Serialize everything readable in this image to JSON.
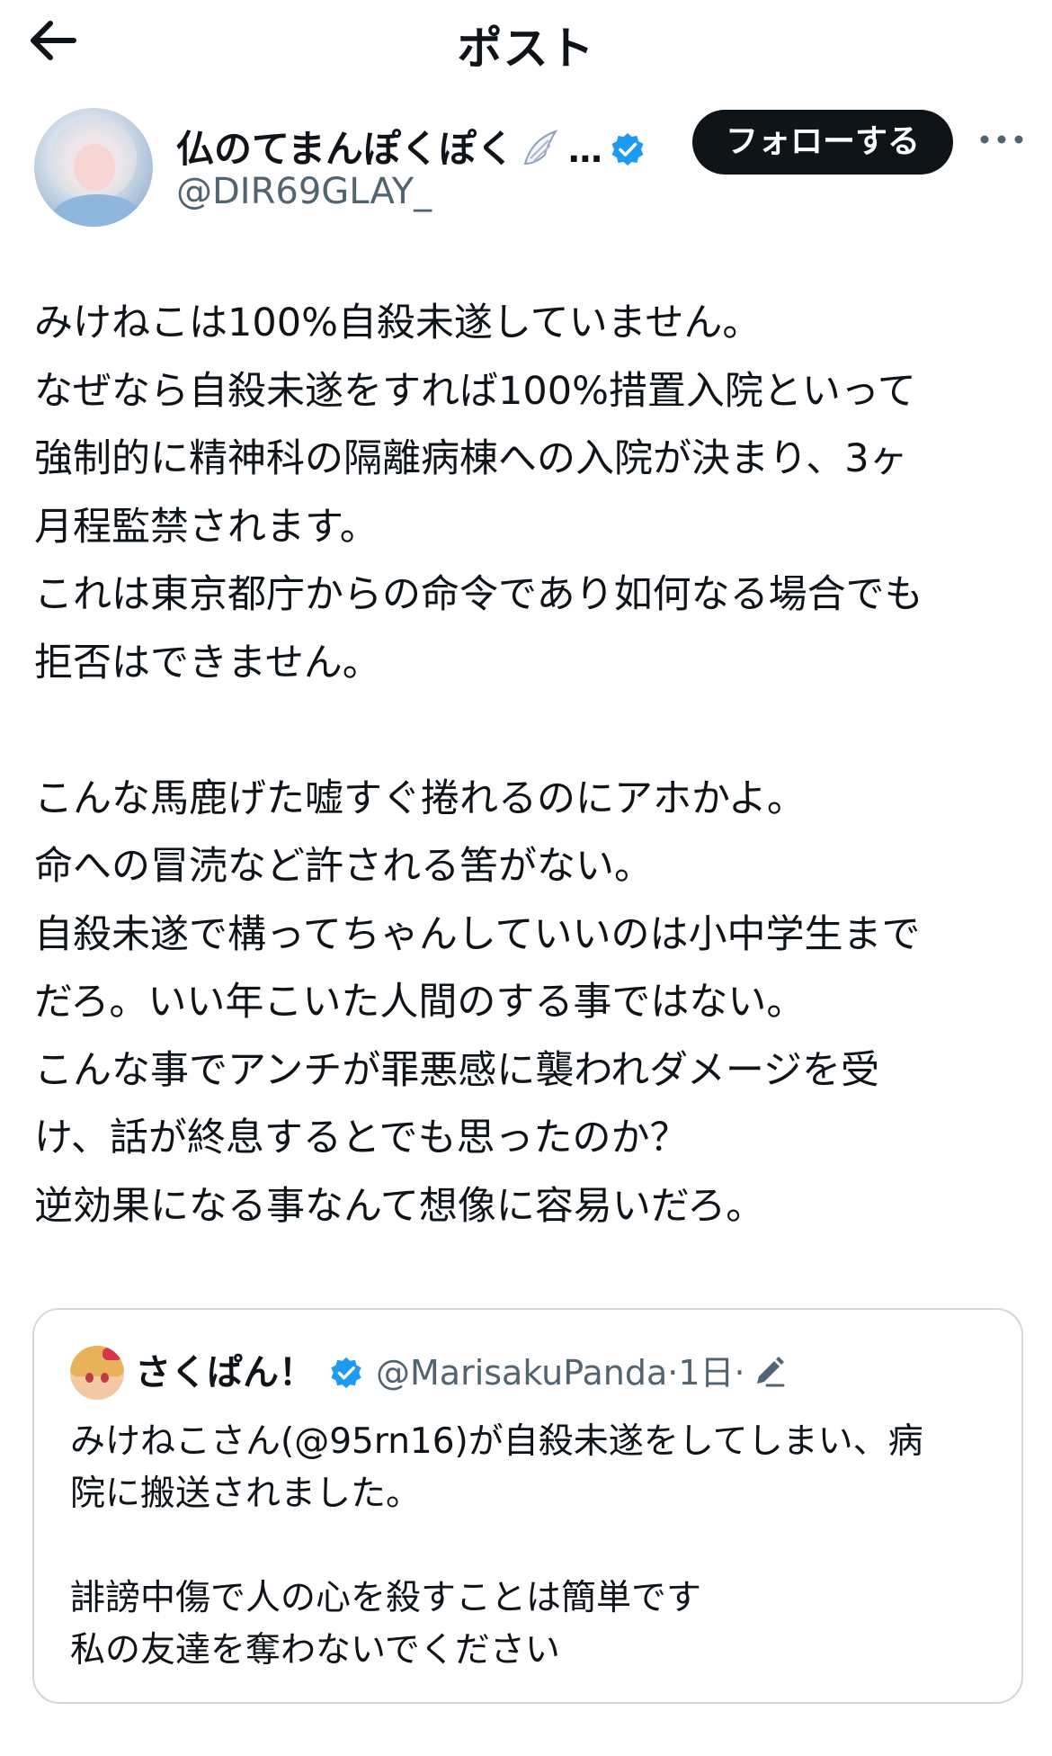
{
  "header": {
    "title": "ポスト"
  },
  "author": {
    "display_name": "仏のてまんぽくぽく",
    "name_ellipsis": "…",
    "handle": "@DIR69GLAY_",
    "follow_label": "フォローする"
  },
  "post": {
    "lines": [
      "みけねこは100%自殺未遂していません。",
      "なぜなら自殺未遂をすれば100%措置入院といって",
      "強制的に精神科の隔離病棟への入院が決まり、3ヶ",
      "月程監禁されます。",
      "これは東京都庁からの命令であり如何なる場合でも",
      "拒否はできません。",
      "",
      "こんな馬鹿げた嘘すぐ捲れるのにアホかよ。",
      "命への冒涜など許される筈がない。",
      "自殺未遂で構ってちゃんしていいのは小中学生まで",
      "だろ。いい年こいた人間のする事ではない。",
      "こんな事でアンチが罪悪感に襲われダメージを受",
      "け、話が終息するとでも思ったのか？",
      "逆効果になる事なんて想像に容易いだろ。"
    ]
  },
  "quote": {
    "display_name": "さくぱん！",
    "handle": "@MarisakuPanda",
    "separator": "·",
    "time": "1日",
    "lines": [
      "みけねこさん(@95rn16)が自殺未遂をしてしまい、病",
      "院に搬送されました。",
      "",
      "誹謗中傷で人の心を殺すことは簡単です",
      "私の友達を奪わないでください"
    ]
  },
  "icons": {
    "back": "arrow-left-icon",
    "verified": "verified-badge-icon",
    "wing": "wing-emoji-icon",
    "more": "more-horizontal-icon",
    "edit": "edit-pencil-icon"
  },
  "colors": {
    "verified": "#1d9bf0",
    "follow_button_bg": "#0f1419",
    "secondary_text": "#536471",
    "border": "#cfd9de"
  }
}
